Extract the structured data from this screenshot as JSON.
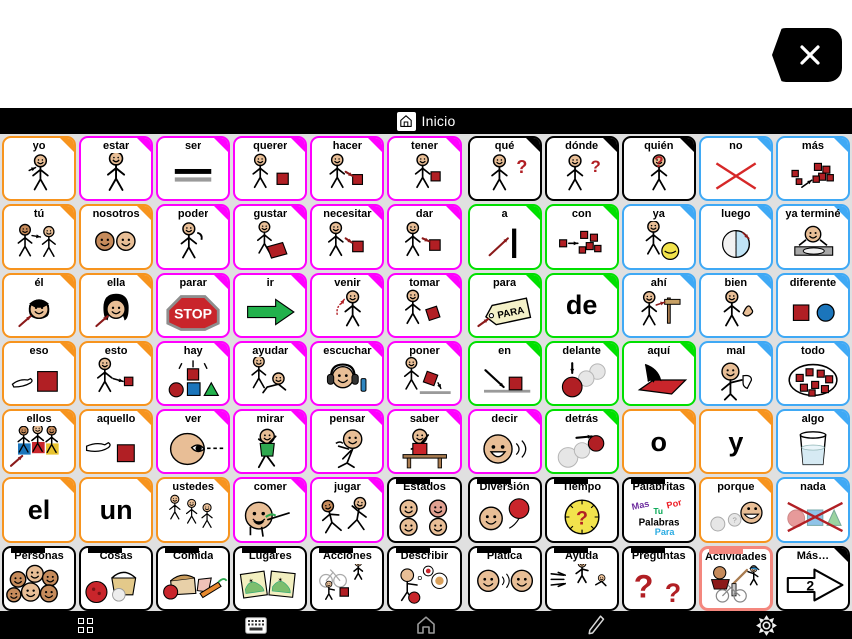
{
  "app": {
    "title_bar": {
      "label": "Inicio",
      "icon": "home-icon"
    },
    "close_button": {
      "icon": "close-x-icon",
      "label": ""
    }
  },
  "colors": {
    "orange": "#F7941E",
    "magenta": "#FF00FF",
    "green": "#00E000",
    "blue": "#3FA9F5",
    "black": "#000000",
    "selected_highlight": "#F4877E",
    "page_bg": "#E0E0E0",
    "bar_bg": "#000000"
  },
  "grid": {
    "columns": 12,
    "rows": 7,
    "cells": [
      {
        "label": "yo",
        "border": "#F7941E",
        "corner": "#F7941E",
        "art": "person-pointing-self",
        "r": 0,
        "c": 0
      },
      {
        "label": "estar",
        "border": "#FF00FF",
        "corner": "#FF00FF",
        "art": "person-standing",
        "r": 0,
        "c": 1
      },
      {
        "label": "ser",
        "border": "#FF00FF",
        "corner": "#FF00FF",
        "art": "equals-bars",
        "r": 0,
        "c": 2
      },
      {
        "label": "querer",
        "border": "#FF00FF",
        "corner": "#FF00FF",
        "art": "person-reaching-red-block",
        "r": 0,
        "c": 3
      },
      {
        "label": "hacer",
        "border": "#FF00FF",
        "corner": "#FF00FF",
        "art": "person-making",
        "r": 0,
        "c": 4
      },
      {
        "label": "tener",
        "border": "#FF00FF",
        "corner": "#FF00FF",
        "art": "person-holding-red",
        "r": 0,
        "c": 5
      },
      {
        "label": "qué",
        "border": "#000000",
        "corner": "#000000",
        "art": "person-shrug-question",
        "r": 0,
        "c": 6
      },
      {
        "label": "dónde",
        "border": "#000000",
        "corner": "#000000",
        "art": "person-looking-question",
        "r": 0,
        "c": 7
      },
      {
        "label": "quién",
        "border": "#000000",
        "corner": "#000000",
        "art": "person-question-head",
        "r": 0,
        "c": 8
      },
      {
        "label": "no",
        "border": "#3FA9F5",
        "corner": "#3FA9F5",
        "art": "red-x-cross",
        "r": 0,
        "c": 9
      },
      {
        "label": "más",
        "border": "#3FA9F5",
        "corner": "#3FA9F5",
        "art": "more-blocks-arrow",
        "r": 0,
        "c": 10
      },
      {
        "label": "tú",
        "border": "#F7941E",
        "corner": "#F7941E",
        "art": "two-people-pointing",
        "r": 1,
        "c": 0
      },
      {
        "label": "nosotros",
        "border": "#F7941E",
        "corner": "#F7941E",
        "art": "two-heads",
        "r": 1,
        "c": 1
      },
      {
        "label": "poder",
        "border": "#FF00FF",
        "corner": "#FF00FF",
        "art": "person-flexing",
        "r": 1,
        "c": 2
      },
      {
        "label": "gustar",
        "border": "#FF00FF",
        "corner": "#FF00FF",
        "art": "person-hugging-red",
        "r": 1,
        "c": 3
      },
      {
        "label": "necesitar",
        "border": "#FF00FF",
        "corner": "#FF00FF",
        "art": "person-needing-block",
        "r": 1,
        "c": 4
      },
      {
        "label": "dar",
        "border": "#FF00FF",
        "corner": "#FF00FF",
        "art": "person-giving-block",
        "r": 1,
        "c": 5
      },
      {
        "label": "a",
        "border": "#00E000",
        "corner": "#00E000",
        "art": "arrow-to-bar",
        "r": 1,
        "c": 6
      },
      {
        "label": "con",
        "border": "#00E000",
        "corner": "#00E000",
        "art": "blocks-joining",
        "r": 1,
        "c": 7
      },
      {
        "label": "ya",
        "border": "#3FA9F5",
        "corner": "#3FA9F5",
        "art": "person-with-ball",
        "r": 1,
        "c": 8
      },
      {
        "label": "luego",
        "border": "#3FA9F5",
        "corner": "#3FA9F5",
        "art": "clock-later",
        "r": 1,
        "c": 9
      },
      {
        "label": "ya terminé",
        "border": "#3FA9F5",
        "corner": "#3FA9F5",
        "art": "person-finished-plate",
        "r": 1,
        "c": 10
      },
      {
        "label": "él",
        "border": "#F7941E",
        "corner": "#F7941E",
        "art": "boy-head-arrow",
        "r": 2,
        "c": 0
      },
      {
        "label": "ella",
        "border": "#F7941E",
        "corner": "#F7941E",
        "art": "girl-head-arrow",
        "r": 2,
        "c": 1
      },
      {
        "label": "parar",
        "border": "#FF00FF",
        "corner": "#FF00FF",
        "art": "stop-sign",
        "r": 2,
        "c": 2
      },
      {
        "label": "ir",
        "border": "#FF00FF",
        "corner": "#FF00FF",
        "art": "green-arrow-right",
        "r": 2,
        "c": 3
      },
      {
        "label": "venir",
        "border": "#FF00FF",
        "corner": "#FF00FF",
        "art": "person-come-here",
        "r": 2,
        "c": 4
      },
      {
        "label": "tomar",
        "border": "#FF00FF",
        "corner": "#FF00FF",
        "art": "person-taking-block",
        "r": 2,
        "c": 5
      },
      {
        "label": "para",
        "border": "#00E000",
        "corner": "#00E000",
        "art": "tag-para",
        "r": 2,
        "c": 6
      },
      {
        "label": "de",
        "border": "#00E000",
        "corner": "#00E000",
        "art": "text-de",
        "r": 2,
        "c": 7,
        "bigtext": "de"
      },
      {
        "label": "ahí",
        "border": "#3FA9F5",
        "corner": "#3FA9F5",
        "art": "person-pointing-signpost",
        "r": 2,
        "c": 8
      },
      {
        "label": "bien",
        "border": "#3FA9F5",
        "corner": "#3FA9F5",
        "art": "person-thumbs-up",
        "r": 2,
        "c": 9
      },
      {
        "label": "diferente",
        "border": "#3FA9F5",
        "corner": "#3FA9F5",
        "art": "square-and-circle",
        "r": 2,
        "c": 10
      },
      {
        "label": "eso",
        "border": "#F7941E",
        "corner": "#F7941E",
        "art": "hand-pointing-red-square",
        "r": 3,
        "c": 0
      },
      {
        "label": "esto",
        "border": "#F7941E",
        "corner": "#F7941E",
        "art": "person-pointing-small-square",
        "r": 3,
        "c": 1
      },
      {
        "label": "hay",
        "border": "#FF00FF",
        "corner": "#FF00FF",
        "art": "shapes-exist",
        "r": 3,
        "c": 2
      },
      {
        "label": "ayudar",
        "border": "#FF00FF",
        "corner": "#FF00FF",
        "art": "person-helping",
        "r": 3,
        "c": 3
      },
      {
        "label": "escuchar",
        "border": "#FF00FF",
        "corner": "#FF00FF",
        "art": "person-headphones",
        "r": 3,
        "c": 4
      },
      {
        "label": "poner",
        "border": "#FF00FF",
        "corner": "#FF00FF",
        "art": "person-putting-block",
        "r": 3,
        "c": 5
      },
      {
        "label": "en",
        "border": "#00E000",
        "corner": "#00E000",
        "art": "arrow-onto-block",
        "r": 3,
        "c": 6
      },
      {
        "label": "delante",
        "border": "#00E000",
        "corner": "#00E000",
        "art": "circles-front",
        "r": 3,
        "c": 7
      },
      {
        "label": "aquí",
        "border": "#00E000",
        "corner": "#00E000",
        "art": "hand-pointing-ground",
        "r": 3,
        "c": 8
      },
      {
        "label": "mal",
        "border": "#3FA9F5",
        "corner": "#3FA9F5",
        "art": "person-thumbs-down",
        "r": 3,
        "c": 9
      },
      {
        "label": "todo",
        "border": "#3FA9F5",
        "corner": "#3FA9F5",
        "art": "all-blocks-circled",
        "r": 3,
        "c": 10
      },
      {
        "label": "ellos",
        "border": "#F7941E",
        "corner": "#F7941E",
        "art": "group-people-arrow",
        "r": 4,
        "c": 0
      },
      {
        "label": "aquello",
        "border": "#F7941E",
        "corner": "#F7941E",
        "art": "hand-pointing-far-square",
        "r": 4,
        "c": 1
      },
      {
        "label": "ver",
        "border": "#FF00FF",
        "corner": "#FF00FF",
        "art": "eye-looking",
        "r": 4,
        "c": 2
      },
      {
        "label": "mirar",
        "border": "#FF00FF",
        "corner": "#FF00FF",
        "art": "person-watching",
        "r": 4,
        "c": 3
      },
      {
        "label": "pensar",
        "border": "#FF00FF",
        "corner": "#FF00FF",
        "art": "person-thinking",
        "r": 4,
        "c": 4
      },
      {
        "label": "saber",
        "border": "#FF00FF",
        "corner": "#FF00FF",
        "art": "person-raising-hand-desk",
        "r": 4,
        "c": 5
      },
      {
        "label": "decir",
        "border": "#FF00FF",
        "corner": "#FF00FF",
        "art": "face-talking",
        "r": 4,
        "c": 6
      },
      {
        "label": "detrás",
        "border": "#00E000",
        "corner": "#00E000",
        "art": "circles-behind",
        "r": 4,
        "c": 7
      },
      {
        "label": "o",
        "border": "#F7941E",
        "corner": "#F7941E",
        "art": "text-o",
        "r": 4,
        "c": 8,
        "bigtext": "o"
      },
      {
        "label": "y",
        "border": "#F7941E",
        "corner": "#F7941E",
        "art": "text-y",
        "r": 4,
        "c": 9,
        "bigtext": "y"
      },
      {
        "label": "algo",
        "border": "#3FA9F5",
        "corner": "#3FA9F5",
        "art": "glass-of-water",
        "r": 4,
        "c": 10
      },
      {
        "label": "el",
        "border": "#F7941E",
        "corner": "#F7941E",
        "art": "text-el",
        "r": 5,
        "c": 0,
        "bigtext": "el"
      },
      {
        "label": "un",
        "border": "#F7941E",
        "corner": "#F7941E",
        "art": "text-un",
        "r": 5,
        "c": 1,
        "bigtext": "un"
      },
      {
        "label": "ustedes",
        "border": "#F7941E",
        "corner": "#F7941E",
        "art": "three-people",
        "r": 5,
        "c": 2
      },
      {
        "label": "comer",
        "border": "#FF00FF",
        "corner": "#FF00FF",
        "art": "person-eating",
        "r": 5,
        "c": 3
      },
      {
        "label": "jugar",
        "border": "#FF00FF",
        "corner": "#FF00FF",
        "art": "two-people-running",
        "r": 5,
        "c": 4
      },
      {
        "label": "Estados",
        "border": "#000000",
        "corner": "#000000",
        "art": "four-faces",
        "r": 5,
        "c": 5,
        "folder": true
      },
      {
        "label": "Diversión",
        "border": "#000000",
        "corner": "#000000",
        "art": "face-balloon",
        "r": 5,
        "c": 6,
        "folder": true
      },
      {
        "label": "Tiempo",
        "border": "#000000",
        "corner": "#000000",
        "art": "clock-question",
        "r": 5,
        "c": 7,
        "folder": true
      },
      {
        "label": "Palabritas",
        "border": "#000000",
        "corner": "#000000",
        "art": "word-cloud",
        "r": 5,
        "c": 8,
        "folder": true
      },
      {
        "label": "porque",
        "border": "#F7941E",
        "corner": "#F7941E",
        "art": "speech-because",
        "r": 5,
        "c": 9
      },
      {
        "label": "nada",
        "border": "#3FA9F5",
        "corner": "#3FA9F5",
        "art": "shapes-crossed-out",
        "r": 5,
        "c": 10
      },
      {
        "label": "Personas",
        "border": "#000000",
        "corner": "#000000",
        "art": "crowd-faces",
        "r": 6,
        "c": 0,
        "folder": true
      },
      {
        "label": "Cosas",
        "border": "#000000",
        "corner": "#000000",
        "art": "basket-ball-toy",
        "r": 6,
        "c": 1,
        "folder": true
      },
      {
        "label": "Comida",
        "border": "#000000",
        "corner": "#000000",
        "art": "bread-apple-carrot",
        "r": 6,
        "c": 2,
        "folder": true
      },
      {
        "label": "Lugares",
        "border": "#000000",
        "corner": "#000000",
        "art": "two-maps",
        "r": 6,
        "c": 3,
        "folder": true
      },
      {
        "label": "Acciones",
        "border": "#000000",
        "corner": "#000000",
        "art": "bike-walk-push",
        "r": 6,
        "c": 4,
        "folder": true
      },
      {
        "label": "Describir",
        "border": "#000000",
        "corner": "#000000",
        "art": "person-describing-apple",
        "r": 6,
        "c": 5,
        "folder": true
      },
      {
        "label": "Plática",
        "border": "#000000",
        "corner": "#000000",
        "art": "two-faces-talking",
        "r": 6,
        "c": 6,
        "folder": true
      },
      {
        "label": "Ayuda",
        "border": "#000000",
        "corner": "#000000",
        "art": "person-helping-up",
        "r": 6,
        "c": 7,
        "folder": true
      },
      {
        "label": "Preguntas",
        "border": "#000000",
        "corner": "#000000",
        "art": "two-question-marks",
        "r": 6,
        "c": 8,
        "folder": true
      },
      {
        "label": "Actividades",
        "border": "#F4877E",
        "corner": "#F4877E",
        "art": "bike-bat-person",
        "r": 6,
        "c": 9,
        "folder": true,
        "selected": true
      },
      {
        "label": "Más…",
        "border": "#000000",
        "corner": "#000000",
        "art": "arrow-right-page-2",
        "r": 6,
        "c": 10,
        "page_number": "2"
      }
    ]
  },
  "palabritas": {
    "title": "Palabritas",
    "words": [
      {
        "text": "Mas",
        "color": "#7030A0"
      },
      {
        "text": "Tu",
        "color": "#00A651"
      },
      {
        "text": "Por",
        "color": "#ED1C24"
      },
      {
        "text": "Palabras",
        "color": "#000000"
      },
      {
        "text": "Para",
        "color": "#29ABE2"
      }
    ]
  },
  "stop_sign": {
    "text": "STOP"
  },
  "para_tag": {
    "text": "PARA"
  },
  "mas_arrow": {
    "number": "2"
  },
  "navbar": {
    "items": [
      {
        "name": "recent-apps-icon",
        "label": ""
      },
      {
        "name": "keyboard-icon",
        "label": ""
      },
      {
        "name": "home-icon",
        "label": ""
      },
      {
        "name": "stylus-pencil-icon",
        "label": ""
      },
      {
        "name": "settings-gear-icon",
        "label": ""
      }
    ]
  }
}
